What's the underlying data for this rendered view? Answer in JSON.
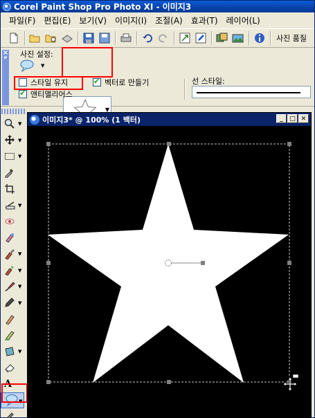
{
  "window": {
    "title": "Corel Paint Shop Pro Photo XI - 이미지3"
  },
  "menu": {
    "items": [
      "파일(F)",
      "편집(E)",
      "보기(V)",
      "이미지(I)",
      "조절(A)",
      "효과(T)",
      "레이어(L)"
    ]
  },
  "toolbar": {
    "buttons": [
      "new-icon",
      "open-icon",
      "browse-icon",
      "scan-icon",
      "save-icon",
      "save-as-icon",
      "print-icon",
      "undo-icon",
      "redo-icon",
      "resize-icon",
      "edit-icon",
      "organizer-icon",
      "photo-icon",
      "info-icon"
    ],
    "right_label": "사진 품질"
  },
  "tool_options": {
    "preset_label": "사진 설정:",
    "shape_selected": "star-shape",
    "retain_style_label": "스타일 유지",
    "retain_style_checked": false,
    "create_vector_label": "벡터로 만들기",
    "create_vector_checked": true,
    "antialias_label": "앤티앨리어스",
    "antialias_checked": true,
    "line_style_label": "선 스타일:"
  },
  "tools": {
    "items": [
      "zoom-tool",
      "move-tool",
      "selection-tool",
      "dropper-tool",
      "crop-tool",
      "straighten-tool",
      "red-eye-tool",
      "makeover-tool",
      "clone-tool",
      "scratch-tool",
      "brush-tool",
      "pen-tool",
      "lighten-tool",
      "smudge-tool",
      "deform-tool",
      "eraser-tool",
      "text-tool",
      "preset-shape-tool",
      "pen-vector-tool"
    ],
    "selected": "preset-shape-tool"
  },
  "document": {
    "title": "이미지3* @ 100% (1 백터)",
    "controls": [
      "minimize",
      "maximize",
      "close"
    ],
    "shape_fill": "#ffffff",
    "background": "#000000"
  },
  "colors": {
    "highlight": "#ff0000",
    "title_active": "#0a246a",
    "chrome": "#ece9d8"
  }
}
